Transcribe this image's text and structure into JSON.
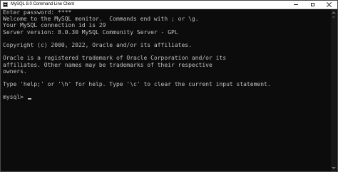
{
  "window": {
    "title": "MySQL 8.0 Command Line Client"
  },
  "console": {
    "lines": [
      "Enter password: ****",
      "Welcome to the MySQL monitor.  Commands end with ; or \\g.",
      "Your MySQL connection id is 29",
      "Server version: 8.0.30 MySQL Community Server - GPL",
      "",
      "Copyright (c) 2000, 2022, Oracle and/or its affiliates.",
      "",
      "Oracle is a registered trademark of Oracle Corporation and/or its",
      "affiliates. Other names may be trademarks of their respective",
      "owners.",
      "",
      "Type 'help;' or '\\h' for help. Type '\\c' to clear the current input statement.",
      ""
    ],
    "prompt": "mysql> "
  },
  "colors": {
    "background": "#0c0c0c",
    "text": "#c0c0c0",
    "titlebar": "#ffffff"
  }
}
